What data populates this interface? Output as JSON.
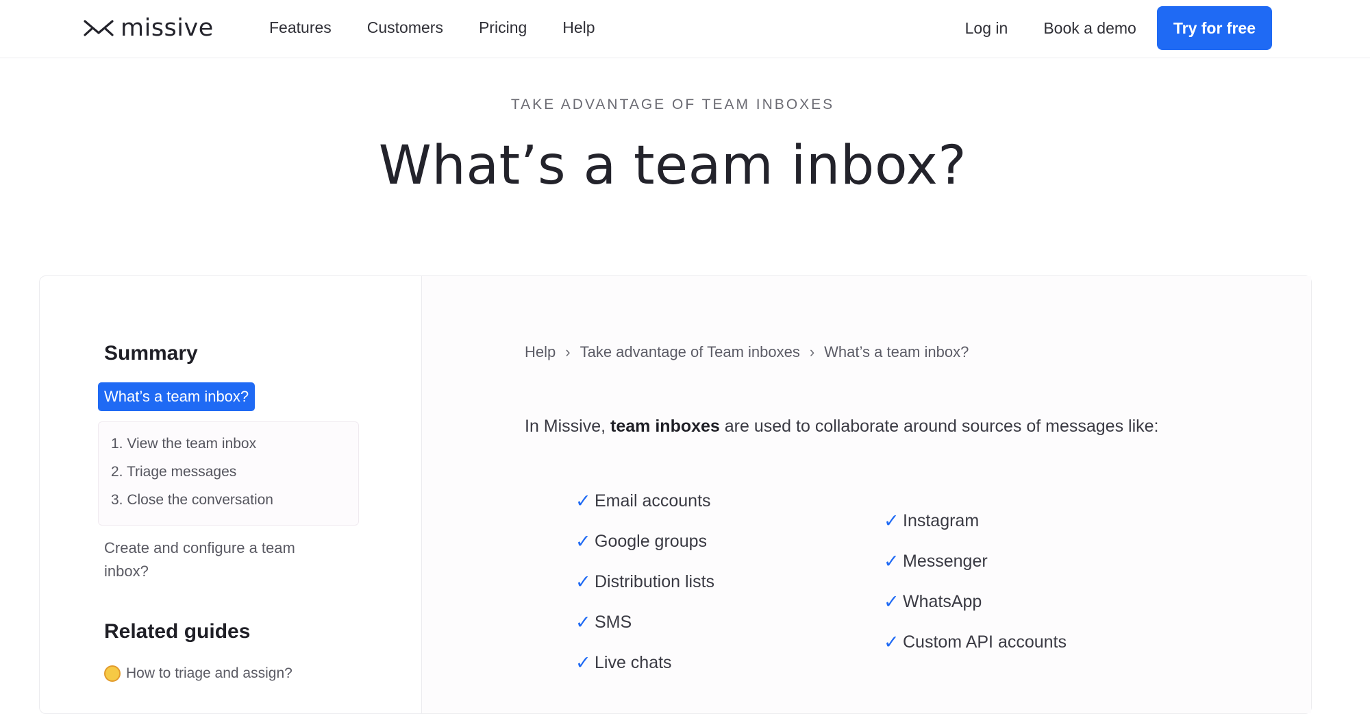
{
  "nav": {
    "logo_text": "missive",
    "links": [
      "Features",
      "Customers",
      "Pricing",
      "Help"
    ],
    "login": "Log in",
    "demo": "Book a demo",
    "cta": "Try for free",
    "accent_color": "#1f6af4"
  },
  "hero": {
    "eyebrow": "TAKE ADVANTAGE OF TEAM INBOXES",
    "title": "What’s a team inbox?"
  },
  "sidebar": {
    "summary_heading": "Summary",
    "active_item": "What’s a team inbox?",
    "sub_items": [
      "1. View the team inbox",
      "2. Triage messages",
      "3. Close the conversation"
    ],
    "next_link": "Create and configure a team inbox?",
    "related_heading": "Related guides",
    "related_guides": [
      {
        "icon": "compass-emoji-icon",
        "label": "How to triage and assign?"
      }
    ]
  },
  "content": {
    "breadcrumb": [
      "Help",
      "Take advantage of Team inboxes",
      "What’s a team inbox?"
    ],
    "intro_before": "In Missive,",
    "intro_bold": "team inboxes",
    "intro_after": "are used to collaborate around sources of messages like:",
    "check_mark": "✓",
    "sources_left": [
      "Email accounts",
      "Google groups",
      "Distribution lists",
      "SMS",
      "Live chats"
    ],
    "sources_right": [
      "Instagram",
      "Messenger",
      "WhatsApp",
      "Custom API accounts"
    ]
  }
}
